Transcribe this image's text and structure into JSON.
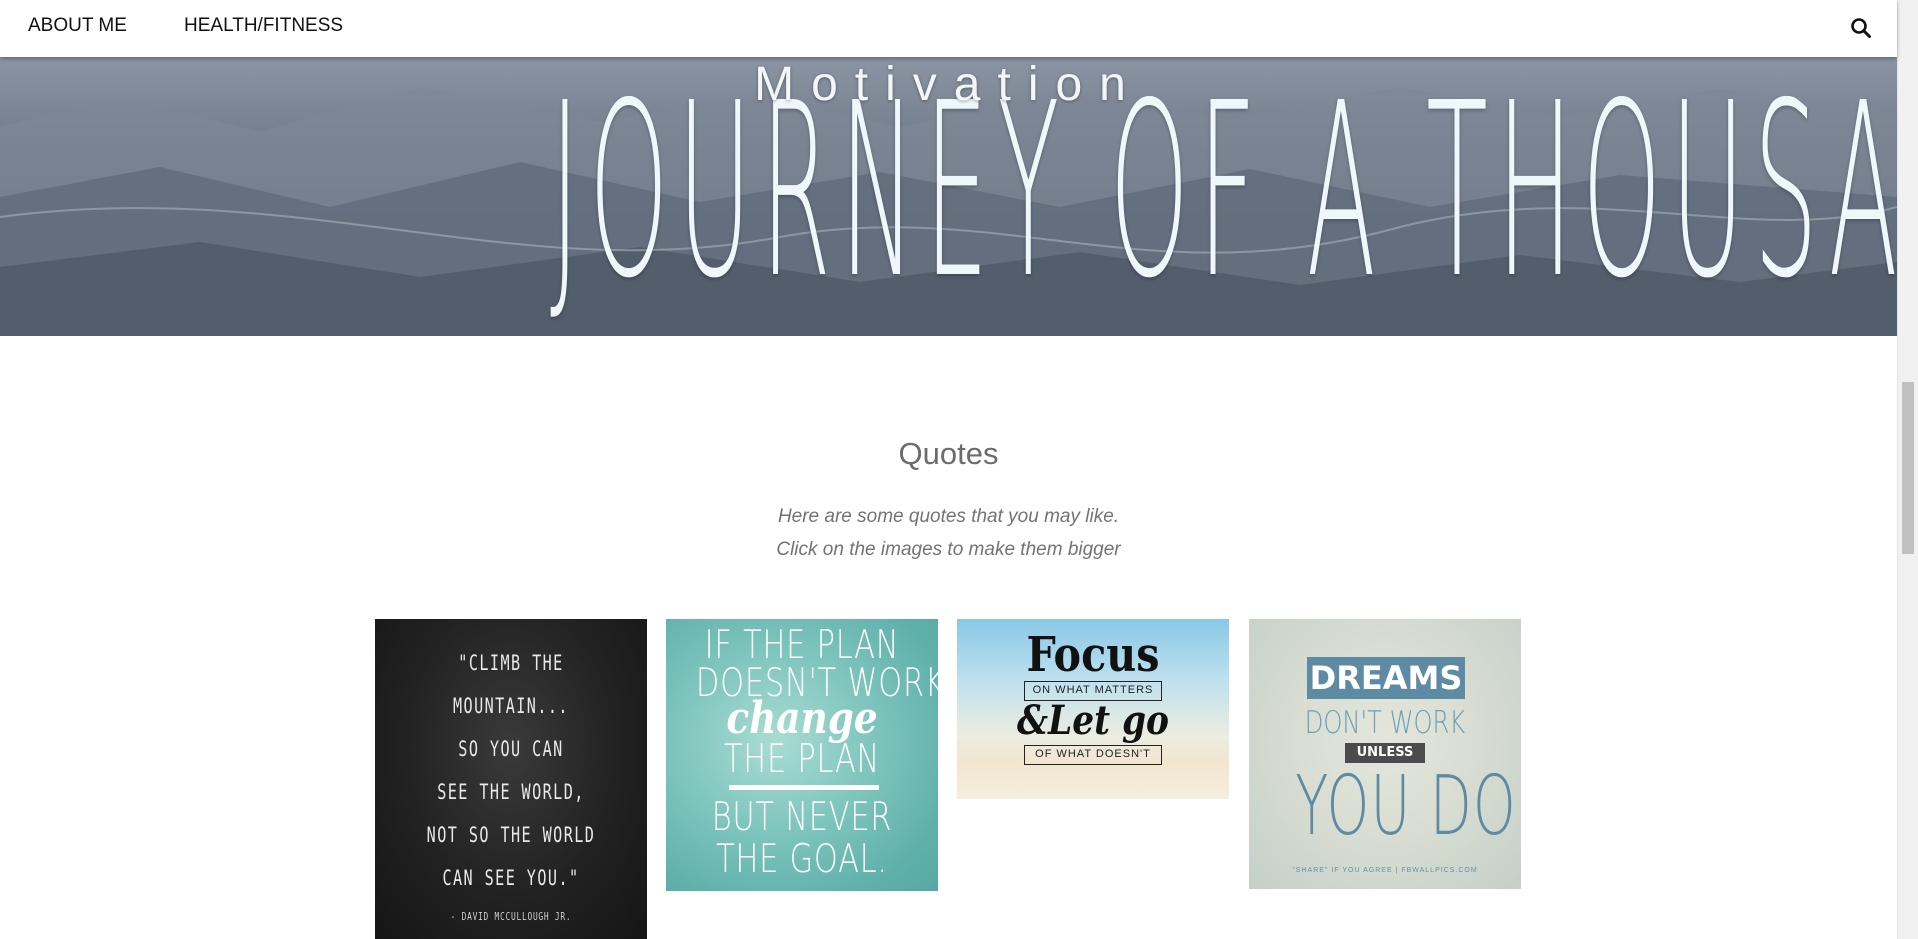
{
  "nav": {
    "items": [
      {
        "label": "ABOUT ME"
      },
      {
        "label": "HEALTH/FITNESS"
      }
    ],
    "search_icon": "search-icon"
  },
  "hero": {
    "title": "Motivation",
    "banner": "JOURNEY OF A THOUSAND MILES"
  },
  "section": {
    "title": "Quotes",
    "subtitle_line1": "Here are some quotes that you may like.",
    "subtitle_line2": "Click on the images to make them bigger"
  },
  "quotes": [
    {
      "lines": [
        "\"CLIMB THE",
        "MOUNTAIN...",
        "SO YOU CAN",
        "SEE THE WORLD,",
        "NOT SO THE WORLD",
        "CAN SEE YOU.\""
      ],
      "credit": "- DAVID MCCULLOUGH JR."
    },
    {
      "lines": [
        "IF THE PLAN",
        "DOESN'T WORK,",
        "change",
        "THE PLAN",
        "BUT NEVER",
        "THE GOAL."
      ]
    },
    {
      "focus": "Focus",
      "box1": "ON WHAT MATTERS",
      "letgo": "&Let go",
      "box2": "OF WHAT DOESN'T"
    },
    {
      "dreams": "DREAMS",
      "dontwork": "DON'T WORK",
      "unless": "UNLESS",
      "youdo": "YOU DO",
      "footer": "\"SHARE\" IF YOU AGREE | FBWALLPICS.COM"
    }
  ]
}
